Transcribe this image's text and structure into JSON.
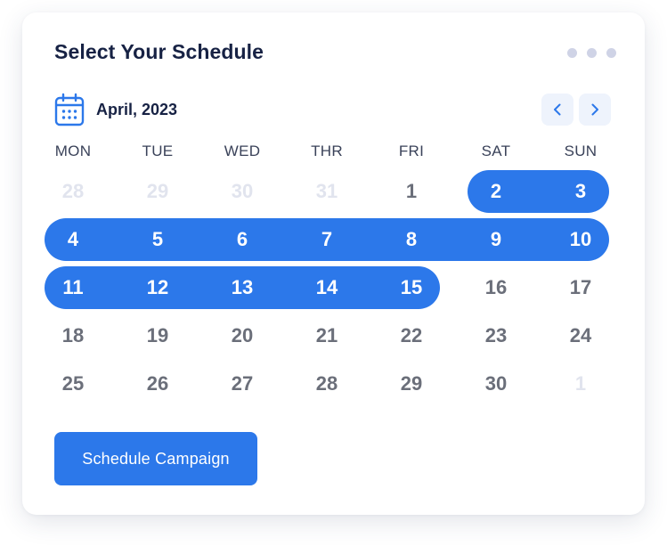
{
  "widget": {
    "title": "Select Your Schedule",
    "month_label": "April, 2023",
    "icons": {
      "calendar": "calendar-icon",
      "more": "more-horizontal-icon",
      "prev": "chevron-left-icon",
      "next": "chevron-right-icon"
    },
    "cta_label": "Schedule Campaign"
  },
  "calendar": {
    "weekdays": [
      "MON",
      "TUE",
      "WED",
      "THR",
      "FRI",
      "SAT",
      "SUN"
    ],
    "weeks": [
      [
        "28",
        "29",
        "30",
        "31",
        "1",
        "2",
        "3"
      ],
      [
        "4",
        "5",
        "6",
        "7",
        "8",
        "9",
        "10"
      ],
      [
        "11",
        "12",
        "13",
        "14",
        "15",
        "16",
        "17"
      ],
      [
        "18",
        "19",
        "20",
        "21",
        "22",
        "23",
        "24"
      ],
      [
        "25",
        "26",
        "27",
        "28",
        "29",
        "30",
        "1"
      ]
    ],
    "outside_month_days": [
      "28",
      "29",
      "30",
      "31",
      "1"
    ],
    "selected_range": {
      "start": "2",
      "end": "15"
    }
  },
  "colors": {
    "accent": "#2c78ea",
    "title_text": "#172244",
    "day_text": "#6b6f7a",
    "muted_day_text": "#e1e4ee",
    "nav_button_bg": "#eef3fc",
    "dots": "#cfd3e6"
  }
}
